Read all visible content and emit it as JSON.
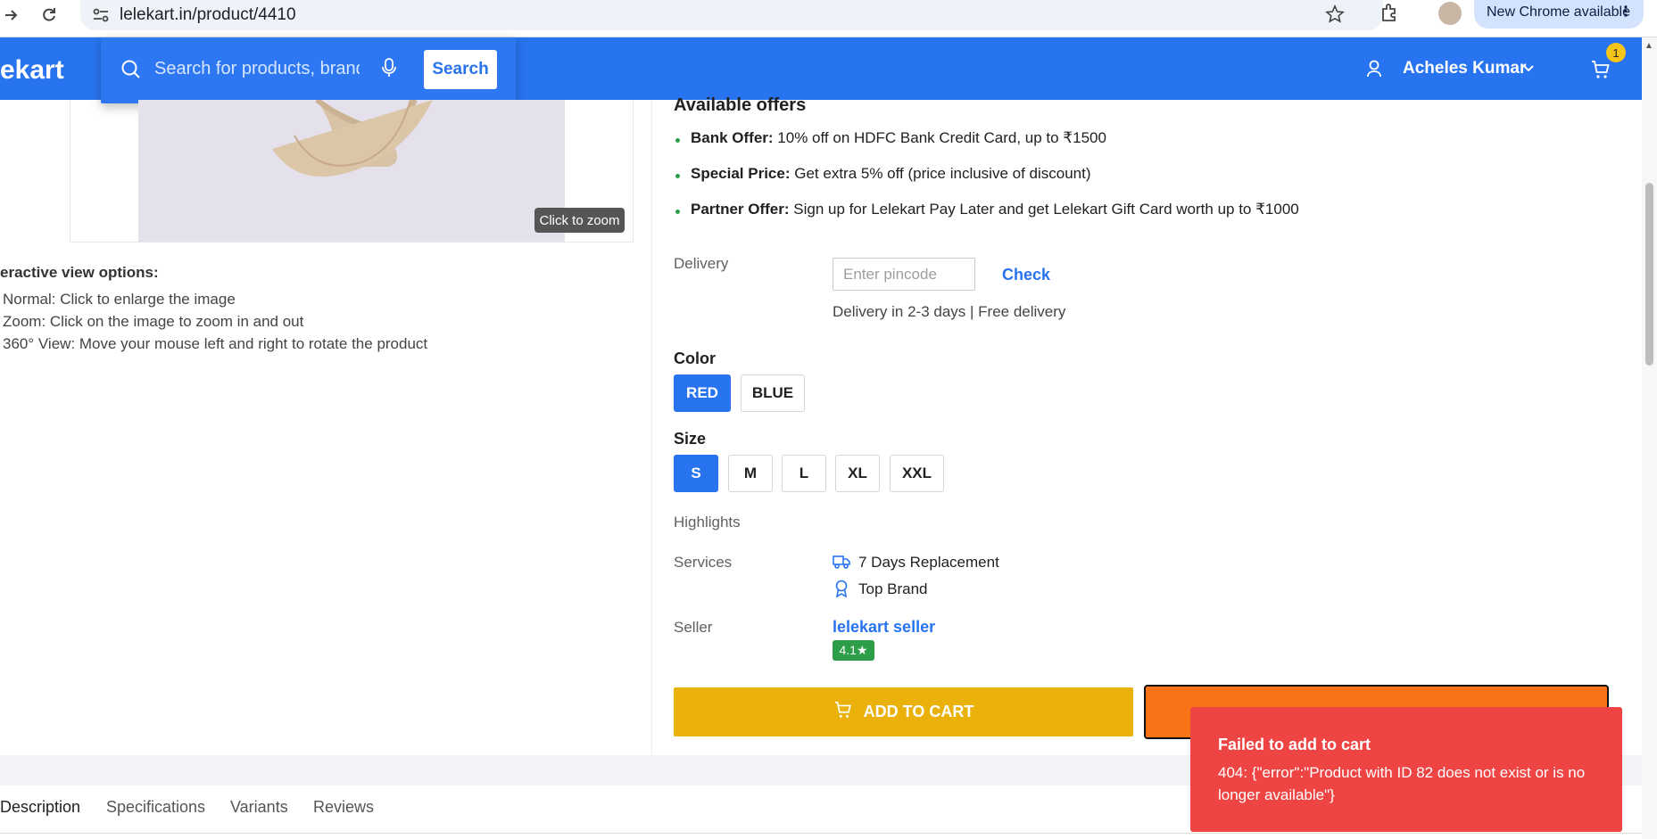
{
  "browser": {
    "url": "lelekart.in/product/4410",
    "new_chrome": "New Chrome available"
  },
  "header": {
    "logo": "ekart",
    "search_placeholder": "Search for products, brands",
    "search_button": "Search",
    "user_name": "Acheles Kumar",
    "cart_count": "1"
  },
  "gallery": {
    "zoom_tip": "Click to zoom",
    "options_title": "eractive view options:",
    "options": [
      "Normal: Click to enlarge the image",
      "Zoom: Click on the image to zoom in and out",
      "360° View: Move your mouse left and right to rotate the product"
    ]
  },
  "offers": {
    "title": "Available offers",
    "items": [
      {
        "label": "Bank Offer:",
        "text": " 10% off on HDFC Bank Credit Card, up to ₹1500"
      },
      {
        "label": "Special Price:",
        "text": " Get extra 5% off (price inclusive of discount)"
      },
      {
        "label": "Partner Offer:",
        "text": " Sign up for Lelekart Pay Later and get Lelekart Gift Card worth up to ₹1000"
      }
    ]
  },
  "delivery": {
    "label": "Delivery",
    "pincode_placeholder": "Enter pincode",
    "check": "Check",
    "info": "Delivery in 2-3 days | Free delivery"
  },
  "color": {
    "title": "Color",
    "options": [
      "RED",
      "BLUE"
    ],
    "selected": "RED"
  },
  "size": {
    "title": "Size",
    "options": [
      "S",
      "M",
      "L",
      "XL",
      "XXL"
    ],
    "selected": "S"
  },
  "highlights_label": "Highlights",
  "services": {
    "label": "Services",
    "items": [
      "7 Days Replacement",
      "Top Brand"
    ]
  },
  "seller": {
    "label": "Seller",
    "name": "lelekart seller",
    "rating": "4.1★"
  },
  "actions": {
    "add_to_cart": "ADD TO CART"
  },
  "tabs": [
    "Description",
    "Specifications",
    "Variants",
    "Reviews"
  ],
  "toast": {
    "title": "Failed to add to cart",
    "message": "404: {\"error\":\"Product with ID 82 does not exist or is no longer available\"}"
  },
  "colors": {
    "brand": "#2874f0",
    "add_to_cart": "#e9b10a",
    "buy_now": "#f97316",
    "error": "#ef4444",
    "rating": "#2e9d47"
  }
}
